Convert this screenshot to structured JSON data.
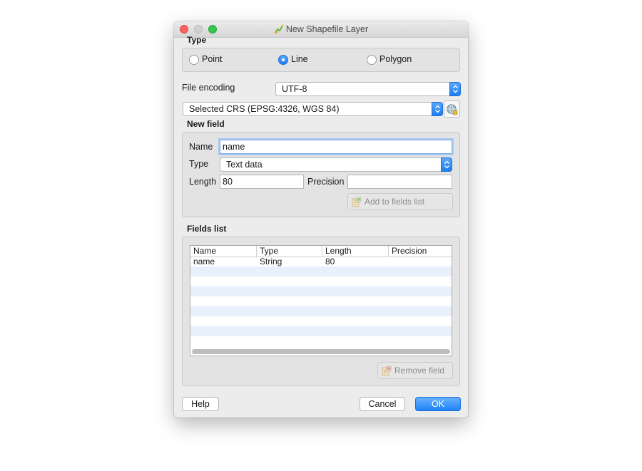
{
  "window": {
    "title": "New Shapefile Layer"
  },
  "type_section": {
    "label": "Type",
    "options": [
      {
        "label": "Point",
        "checked": false
      },
      {
        "label": "Line",
        "checked": true
      },
      {
        "label": "Polygon",
        "checked": false
      }
    ]
  },
  "file_encoding": {
    "label": "File encoding",
    "value": "UTF-8"
  },
  "crs": {
    "value": "Selected CRS (EPSG:4326, WGS 84)"
  },
  "new_field": {
    "label": "New field",
    "name_label": "Name",
    "name_value": "name",
    "type_label": "Type",
    "type_value": "Text data",
    "length_label": "Length",
    "length_value": "80",
    "precision_label": "Precision",
    "precision_value": "",
    "add_button": "Add to fields list"
  },
  "fields_list": {
    "label": "Fields list",
    "columns": [
      "Name",
      "Type",
      "Length",
      "Precision"
    ],
    "rows": [
      {
        "name": "name",
        "type": "String",
        "length": "80",
        "precision": ""
      }
    ],
    "remove_button": "Remove field"
  },
  "buttons": {
    "help": "Help",
    "cancel": "Cancel",
    "ok": "OK"
  },
  "colors": {
    "accent": "#1e82f5",
    "alt_row": "#e8f0fb"
  }
}
